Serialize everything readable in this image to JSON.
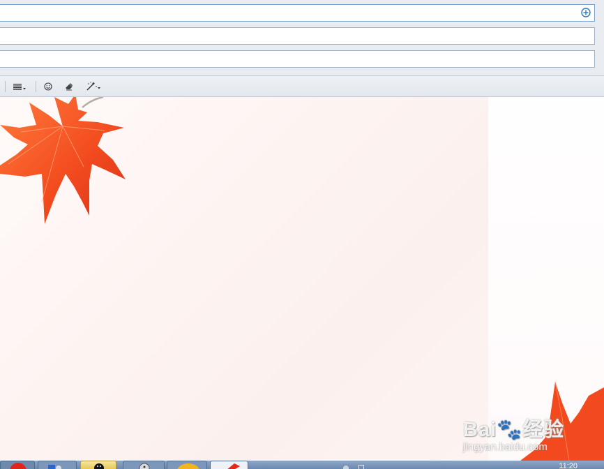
{
  "compose": {
    "to_value": "",
    "cc_value": "",
    "subject_value": "",
    "add_recipient_icon": "plus-circle-icon"
  },
  "toolbar": {
    "buttons": [
      {
        "name": "align-button",
        "icon": "align-lines-icon",
        "has_dropdown": true
      },
      {
        "name": "emoji-button",
        "icon": "smiley-icon",
        "has_dropdown": false
      },
      {
        "name": "clear-format-button",
        "icon": "eraser-icon",
        "has_dropdown": false
      },
      {
        "name": "magic-wand-button",
        "icon": "magic-wand-icon",
        "has_dropdown": true
      }
    ]
  },
  "editor": {
    "body_text": "",
    "background": "maple-leaf-stationery",
    "leaf_color": "#f24a1e"
  },
  "taskbar": {
    "clock": "11:20",
    "items": [
      {
        "name": "taskbar-app-red",
        "icon": "red-circle-icon"
      },
      {
        "name": "taskbar-app-contacts",
        "icon": "contacts-icon"
      },
      {
        "name": "taskbar-app-qq",
        "icon": "penguin-icon"
      },
      {
        "name": "taskbar-app-chat",
        "icon": "chat-icon"
      },
      {
        "name": "taskbar-app-yellow",
        "icon": "yellow-circle-icon"
      },
      {
        "name": "taskbar-app-leaf",
        "icon": "leaf-icon"
      }
    ]
  },
  "watermark": {
    "brand": "Bai🐾经验",
    "url": "jingyan.baidu.com"
  },
  "colors": {
    "accent": "#2b78c5",
    "toolbar_bg": "#e6eaef",
    "field_border": "#9fb0c4",
    "taskbar": "#7f9bc0"
  }
}
